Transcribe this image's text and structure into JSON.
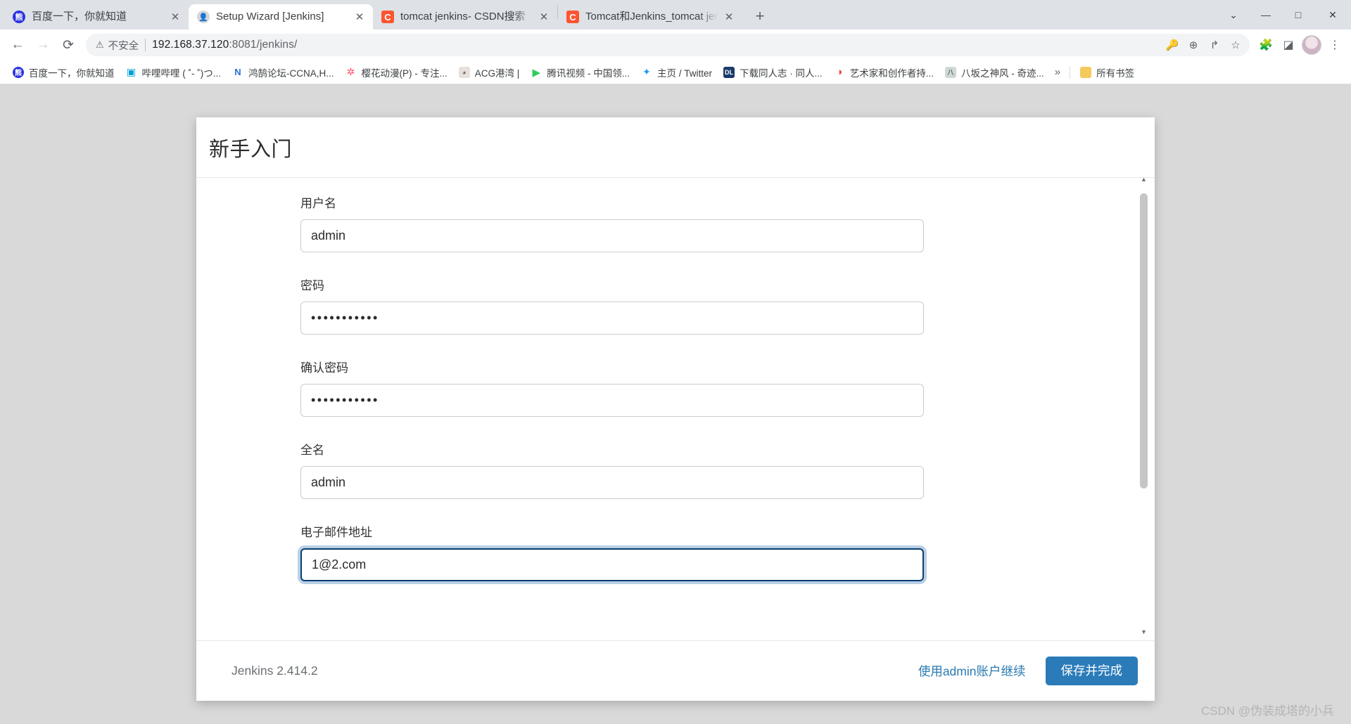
{
  "browser": {
    "tabs": [
      {
        "title": "百度一下，你就知道",
        "favicon": "baidu-icon",
        "active": false
      },
      {
        "title": "Setup Wizard [Jenkins]",
        "favicon": "jenkins-icon",
        "active": true
      },
      {
        "title": "tomcat jenkins- CSDN搜索",
        "favicon": "csdn-icon",
        "active": false
      },
      {
        "title": "Tomcat和Jenkins_tomcat jenki",
        "favicon": "csdn-icon",
        "active": false
      }
    ],
    "new_tab_label": "+",
    "window_controls": {
      "minimize": "—",
      "maximize": "□",
      "close": "✕",
      "chevron": "⌄"
    },
    "toolbar": {
      "back": "←",
      "forward": "→",
      "reload": "⟳",
      "security_icon": "warning-triangle-icon",
      "security_text": "不安全",
      "url": "192.168.37.120:8081/jenkins/",
      "url_host": "192.168.37.120",
      "url_rest": ":8081/jenkins/",
      "omni_icons": [
        "key-icon",
        "zoom-icon",
        "share-icon",
        "star-icon"
      ],
      "extensions_icon": "puzzle-icon",
      "sidepanel_icon": "side-panel-icon",
      "profile_icon": "avatar",
      "menu_icon": "three-dot-menu-icon"
    },
    "bookmarks": [
      {
        "label": "百度一下，你就知道",
        "icon": "baidu-icon",
        "glyph": "熊"
      },
      {
        "label": "哔哩哔哩 ( ˚- ˚)つ...",
        "icon": "bilibili-icon",
        "glyph": "📺"
      },
      {
        "label": "鸿鹄论坛-CCNA,H...",
        "icon": "honghu-icon",
        "glyph": "N"
      },
      {
        "label": "樱花动漫(P) - 专注...",
        "icon": "sakura-icon",
        "glyph": "✿"
      },
      {
        "label": "ACG港湾 |",
        "icon": "acg-icon",
        "glyph": "A"
      },
      {
        "label": "腾讯视频 - 中国领...",
        "icon": "tencent-video-icon",
        "glyph": "▶"
      },
      {
        "label": "主页 / Twitter",
        "icon": "twitter-icon",
        "glyph": "🐦"
      },
      {
        "label": "下载同人志 · 同人...",
        "icon": "dl-icon",
        "glyph": "DL"
      },
      {
        "label": "艺术家和创作者持...",
        "icon": "patreon-icon",
        "glyph": "◑"
      },
      {
        "label": "八坂之神风 - 奇迹...",
        "icon": "yasaka-icon",
        "glyph": "八"
      }
    ],
    "bookmarks_overflow": "»",
    "all_bookmarks": {
      "label": "所有书签",
      "icon": "folder-icon"
    }
  },
  "dialog": {
    "title": "新手入门",
    "fields": [
      {
        "name": "username",
        "label": "用户名",
        "value": "admin",
        "type": "text",
        "focused": false
      },
      {
        "name": "password",
        "label": "密码",
        "value": "•••••••••••",
        "type": "password",
        "focused": false
      },
      {
        "name": "confirm",
        "label": "确认密码",
        "value": "•••••••••••",
        "type": "password",
        "focused": false
      },
      {
        "name": "fullname",
        "label": "全名",
        "value": "admin",
        "type": "text",
        "focused": false
      },
      {
        "name": "email",
        "label": "电子邮件地址",
        "value": "1@2.com",
        "type": "email",
        "focused": true
      }
    ],
    "footer": {
      "version": "Jenkins 2.414.2",
      "secondary_link": "使用admin账户继续",
      "primary_button": "保存并完成"
    },
    "scrollbar": {
      "up_arrow": "▲",
      "down_arrow": "▼"
    }
  },
  "watermark": "CSDN @伪装成塔的小兵",
  "colors": {
    "primary": "#2b7bb9",
    "link": "#2a7ab0",
    "focus_ring": "#7ea7d1",
    "chrome_tabstrip": "#dee1e6",
    "page_backdrop": "#d9d9d9"
  }
}
